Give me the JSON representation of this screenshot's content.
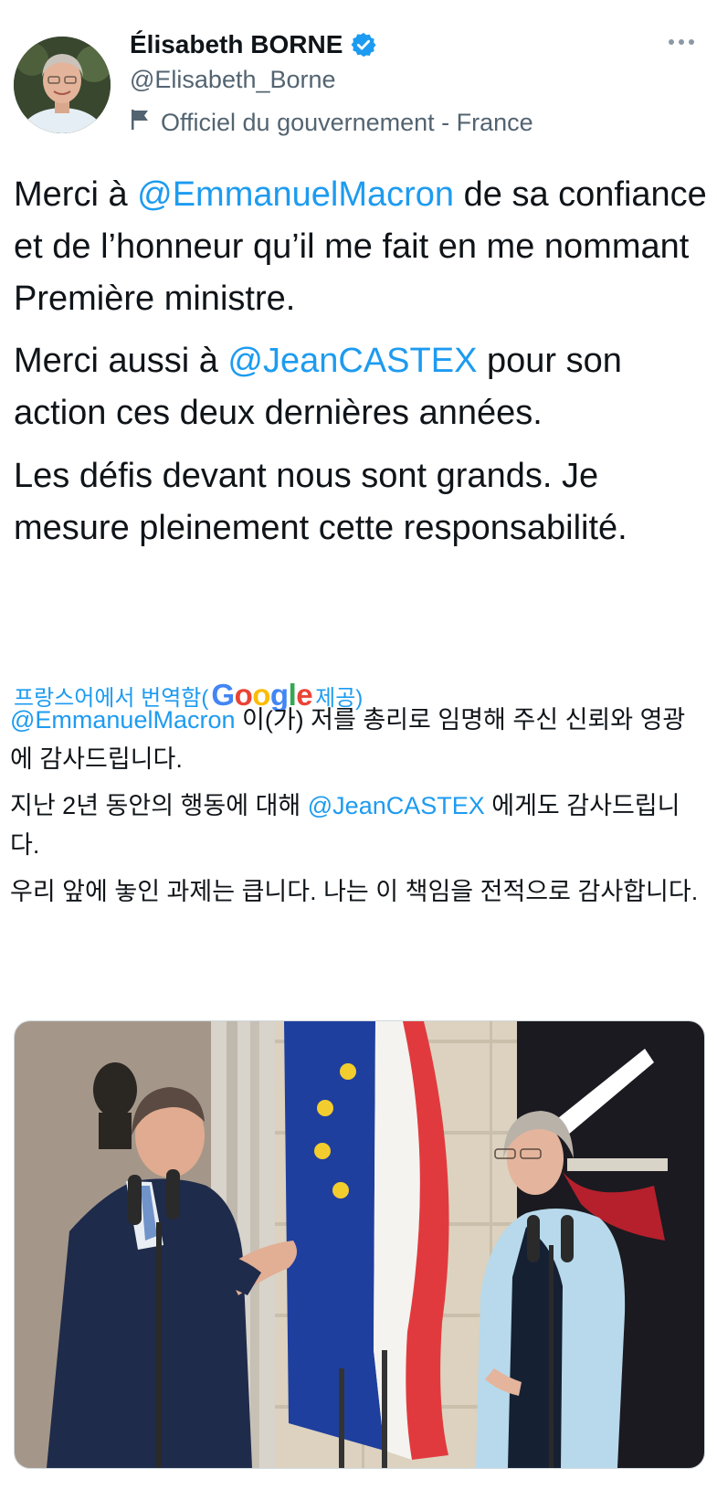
{
  "author": {
    "display_name": "Élisabeth BORNE",
    "handle": "@Elisabeth_Borne",
    "affiliation_label": "Officiel du gouvernement - France",
    "verified_icon": "verified-badge-icon",
    "affiliation_icon": "flag-icon"
  },
  "tweet": {
    "paragraphs": [
      {
        "before": "Merci à ",
        "mention": "@EmmanuelMacron",
        "after": " de sa confiance et de l’honneur qu’il me fait en me nommant Première ministre."
      },
      {
        "before": "Merci aussi à ",
        "mention": "@JeanCASTEX",
        "after": " pour son action ces deux dernières années."
      },
      {
        "text": "Les défis devant nous sont  grands. Je mesure pleinement cette responsabilité."
      }
    ]
  },
  "translation": {
    "label_before": "프랑스어에서 번역함(",
    "provider": "Google",
    "label_after": " 제공)",
    "paragraphs": [
      {
        "mention": "@EmmanuelMacron",
        "after": " 이(가) 저를 총리로 임명해 주신 신뢰와 영광에 감사드립니다."
      },
      {
        "before": " 지난 2년 동안의 행동에 대해 ",
        "mention": "@JeanCASTEX",
        "after": " 에게도 감사드립니다."
      },
      {
        "text": " 우리 앞에 놓인 과제는 큽니다. 나는 이 책임을 전적으로 감사합니다."
      }
    ]
  },
  "colors": {
    "link": "#1d9bf0",
    "text": "#0f1419",
    "secondary": "#536471"
  }
}
